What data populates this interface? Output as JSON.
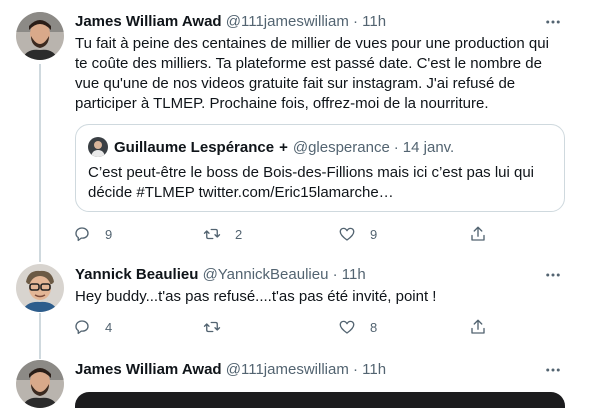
{
  "tweets": [
    {
      "name": "James William Awad",
      "handle": "@111jameswilliam",
      "separator": "·",
      "time": "11h",
      "avatar_icon": "profile-photo-bearded-man",
      "text": "Tu fait à peine des centaines de millier de vues pour une production qui te coûte des milliers. Ta plateforme est passé date. C'est le nombre de vue qu'une de nos videos gratuite fait sur instagram. J'ai refusé de participer à TLMEP. Prochaine fois, offrez-moi de la nourriture.",
      "quote": {
        "name": "Guillaume Lespérance",
        "badge": "+",
        "handle": "@glesperance",
        "separator": "·",
        "time": "14 janv.",
        "avatar_icon": "profile-photo-man",
        "text_line1": "C’est peut-être le boss de Bois-des-Fillions mais ici c’est pas lui qui",
        "text_line2": "décide #TLMEP twitter.com/Eric15lamarche…"
      },
      "actions": {
        "replies": "9",
        "retweets": "2",
        "likes": "9"
      }
    },
    {
      "name": "Yannick Beaulieu",
      "handle": "@YannickBeaulieu",
      "separator": "·",
      "time": "11h",
      "avatar_icon": "profile-photo-man-glasses",
      "text": "Hey buddy...t'as pas refusé....t'as pas été invité, point !",
      "actions": {
        "replies": "4",
        "retweets": "",
        "likes": "8"
      }
    },
    {
      "name": "James William Awad",
      "handle": "@111jameswilliam",
      "separator": "·",
      "time": "11h",
      "avatar_icon": "profile-photo-bearded-man"
    }
  ],
  "icons": {
    "reply": "reply-icon",
    "retweet": "retweet-icon",
    "like": "heart-icon",
    "share": "share-icon",
    "more": "more-icon"
  },
  "colors": {
    "text": "#0f1419",
    "secondary": "#536471",
    "border": "#cfd9de",
    "thread_line": "#cfd9de"
  }
}
